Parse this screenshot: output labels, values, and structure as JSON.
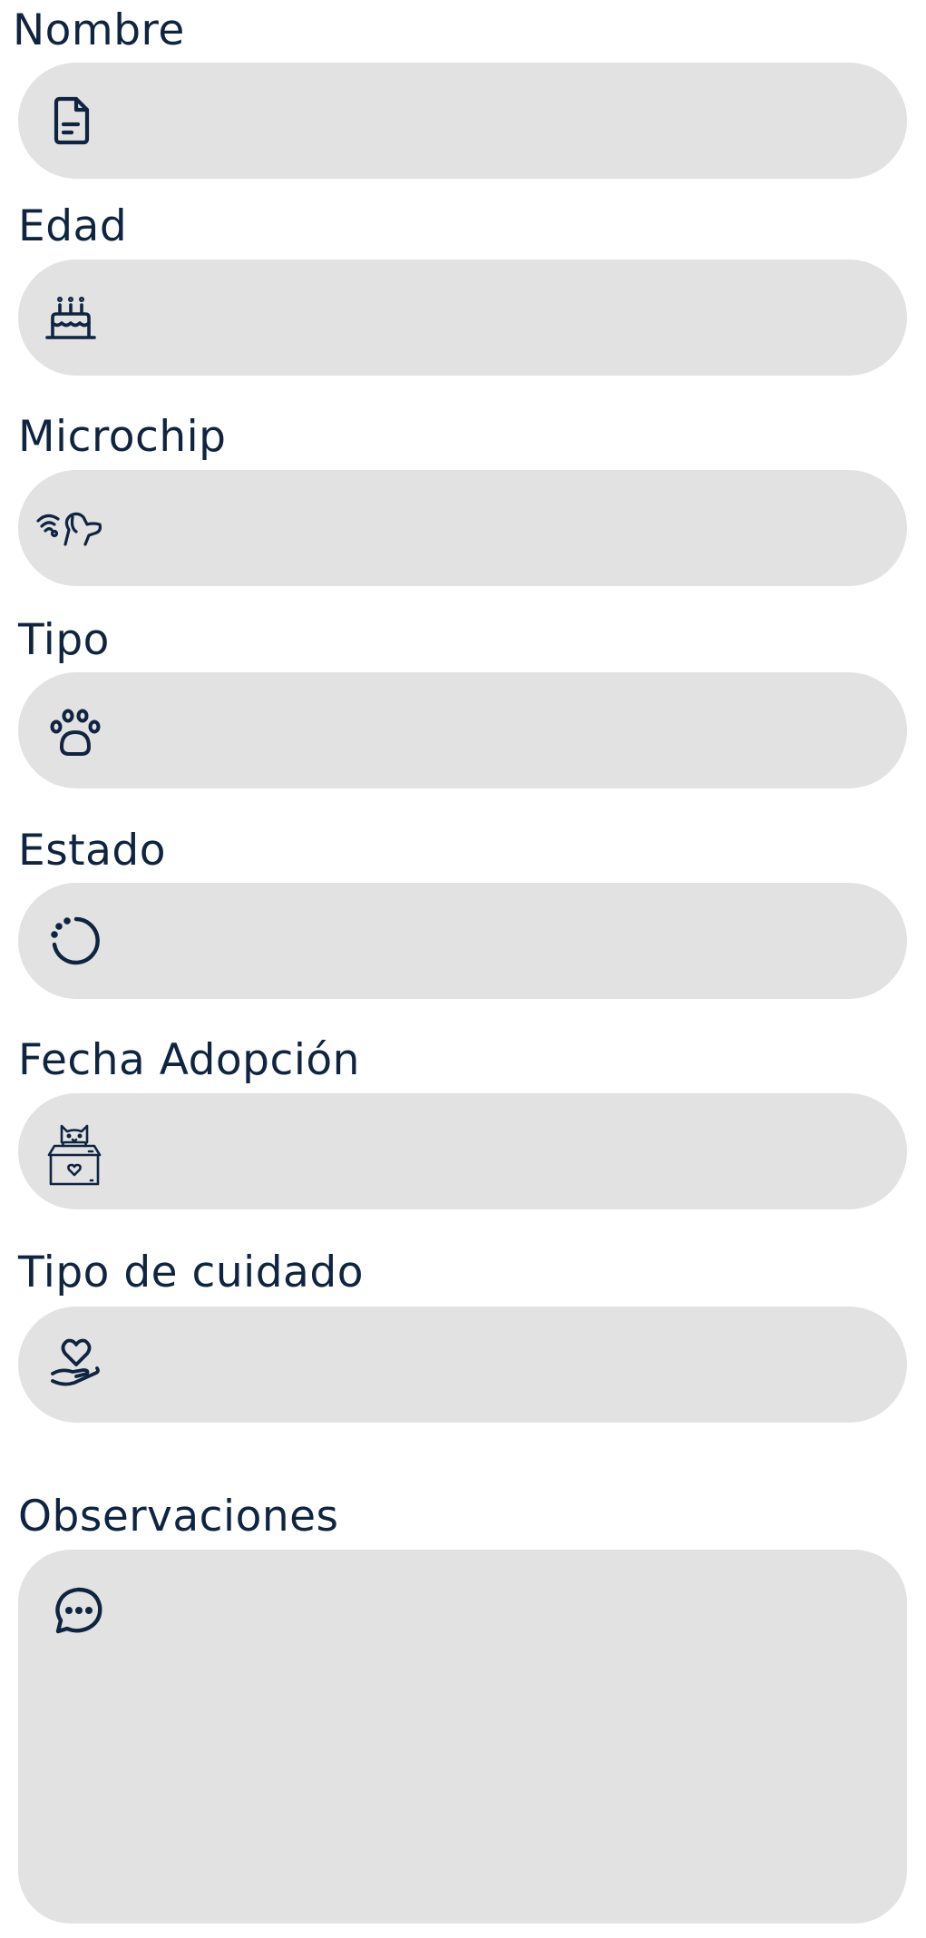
{
  "form": {
    "fields": [
      {
        "label": "Nombre",
        "value": "",
        "placeholder": "",
        "icon": "file-text-icon"
      },
      {
        "label": "Edad",
        "value": "",
        "placeholder": "",
        "icon": "cake-icon"
      },
      {
        "label": "Microchip",
        "value": "",
        "placeholder": "",
        "icon": "microchip-dog-icon"
      },
      {
        "label": "Tipo",
        "value": "",
        "placeholder": "",
        "icon": "paw-icon"
      },
      {
        "label": "Estado",
        "value": "",
        "placeholder": "",
        "icon": "loading-circle-icon"
      },
      {
        "label": "Fecha Adopción",
        "value": "",
        "placeholder": "",
        "icon": "cat-adoption-box-icon"
      },
      {
        "label": "Tipo de cuidado",
        "value": "",
        "placeholder": "",
        "icon": "heart-hand-icon"
      }
    ],
    "observations": {
      "label": "Observaciones",
      "value": "",
      "placeholder": "",
      "icon": "chat-bubble-icon"
    }
  },
  "colors": {
    "text": "#0f2440",
    "field_background": "#e2e2e2",
    "icon": "#0f2440"
  }
}
